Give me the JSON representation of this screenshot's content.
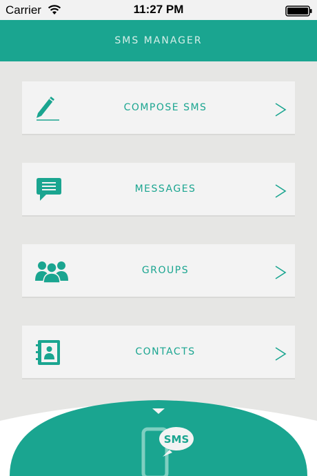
{
  "status_bar": {
    "carrier": "Carrier",
    "time": "11:27 PM"
  },
  "nav": {
    "title": "SMS MANAGER"
  },
  "menu": [
    {
      "label": "COMPOSE SMS",
      "icon": "pencil-icon"
    },
    {
      "label": "MESSAGES",
      "icon": "speech-bubble-icon"
    },
    {
      "label": "GROUPS",
      "icon": "group-icon"
    },
    {
      "label": "CONTACTS",
      "icon": "address-book-icon"
    }
  ],
  "footer": {
    "badge": "SMS"
  },
  "colors": {
    "accent": "#1aa590",
    "background": "#e6e6e4",
    "card": "#f3f3f3"
  }
}
